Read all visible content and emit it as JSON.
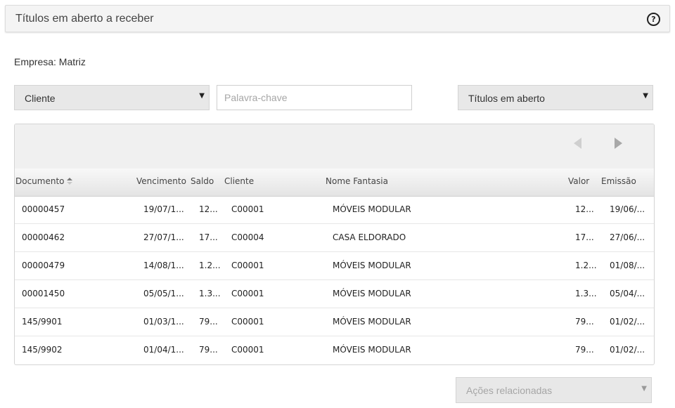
{
  "header": {
    "title": "Títulos em aberto a receber",
    "help_icon": "?"
  },
  "empresa": "Empresa: Matriz",
  "filters": {
    "field_select": "Cliente",
    "search_placeholder": "Palavra-chave",
    "status_select": "Títulos em aberto"
  },
  "grid": {
    "nav": {
      "prev_icon": "triangle-left-icon",
      "next_icon": "triangle-right-icon"
    },
    "columns": {
      "documento": "Documento",
      "vencimento": "Vencimento",
      "saldo": "Saldo",
      "cliente": "Cliente",
      "nome_fantasia": "Nome Fantasia",
      "valor": "Valor",
      "emissao": "Emissão"
    },
    "rows": [
      {
        "documento": "00000457",
        "vencimento": "19/07/1...",
        "saldo": "12...",
        "cliente": "C00001",
        "nome_fantasia": "MÓVEIS MODULAR",
        "valor": "12...",
        "emissao": "19/06/..."
      },
      {
        "documento": "00000462",
        "vencimento": "27/07/1...",
        "saldo": "17...",
        "cliente": "C00004",
        "nome_fantasia": "CASA ELDORADO",
        "valor": "17...",
        "emissao": "27/06/..."
      },
      {
        "documento": "00000479",
        "vencimento": "14/08/1...",
        "saldo": "1.2...",
        "cliente": "C00001",
        "nome_fantasia": "MÓVEIS MODULAR",
        "valor": "1.2...",
        "emissao": "01/08/..."
      },
      {
        "documento": "00001450",
        "vencimento": "05/05/1...",
        "saldo": "1.3...",
        "cliente": "C00001",
        "nome_fantasia": "MÓVEIS MODULAR",
        "valor": "1.3...",
        "emissao": "05/04/..."
      },
      {
        "documento": "145/9901",
        "vencimento": "01/03/1...",
        "saldo": "79...",
        "cliente": "C00001",
        "nome_fantasia": "MÓVEIS MODULAR",
        "valor": "79...",
        "emissao": "01/02/..."
      },
      {
        "documento": "145/9902",
        "vencimento": "01/04/1...",
        "saldo": "79...",
        "cliente": "C00001",
        "nome_fantasia": "MÓVEIS MODULAR",
        "valor": "79...",
        "emissao": "01/02/..."
      }
    ]
  },
  "acoes": {
    "label": "Ações relacionadas"
  }
}
